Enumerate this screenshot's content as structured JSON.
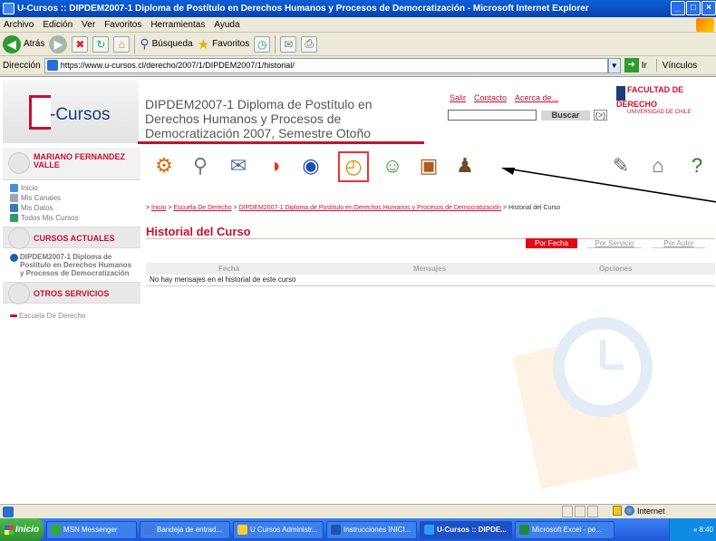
{
  "window": {
    "title": "U-Cursos :: DIPDEM2007-1 Diploma de Postítulo en Derechos Humanos y Procesos de Democratización - Microsoft Internet Explorer",
    "controls": [
      "_",
      "□",
      "×"
    ]
  },
  "menubar": [
    "Archivo",
    "Edición",
    "Ver",
    "Favoritos",
    "Herramientas",
    "Ayuda"
  ],
  "toolbar": {
    "back_label": "Atrás",
    "search_label": "Búsqueda",
    "favorites_label": "Favoritos"
  },
  "address": {
    "label": "Dirección",
    "url": "https://www.u-cursos.cl/derecho/2007/1/DIPDEM2007/1/historial/",
    "go_label": "Ir",
    "links_label": "Vínculos"
  },
  "header": {
    "logo_text": "-Cursos",
    "course_title": "DIPDEM2007-1 Diploma de Postítulo en Derechos Humanos y Procesos de Democratización 2007, Semestre Otoño",
    "links": [
      "Salir",
      "Contacto",
      "Acerca de..."
    ],
    "search_button": "Buscar",
    "search_go": "(>)",
    "faculty_name": "FACULTAD DE DERECHO",
    "faculty_sub": "UNIVERSIDAD DE CHILE"
  },
  "sidebar": {
    "user_name": "MARIANO FERNANDEZ VALLE",
    "links": [
      "Inicio",
      "Mis Canales",
      "Mis Datos",
      "Todos Mis Cursos"
    ],
    "current_heading": "CURSOS ACTUALES",
    "current_course": "DIPDEM2007-1 Diploma de Postítulo en Derechos Humanos y Procesos de Democratización",
    "other_heading": "OTROS SERVICIOS",
    "other_links": [
      "Escuela De Derecho"
    ]
  },
  "iconbar": {
    "icons": [
      {
        "name": "gears-icon",
        "glyph": "⚙",
        "color": "#d96b00"
      },
      {
        "name": "magnifier-icon",
        "glyph": "⚲",
        "color": "#777777"
      },
      {
        "name": "documents-icon",
        "glyph": "✉",
        "color": "#4a6fb0"
      },
      {
        "name": "calendar-icon",
        "glyph": "◑",
        "color": "#d9421a"
      },
      {
        "name": "chart-icon",
        "glyph": "◉",
        "color": "#1c4fb3"
      },
      {
        "name": "history-icon",
        "glyph": "◴",
        "color": "#e08a00"
      },
      {
        "name": "people-icon",
        "glyph": "☺",
        "color": "#2f9a2f"
      },
      {
        "name": "book-icon",
        "glyph": "▣",
        "color": "#b05a20"
      },
      {
        "name": "teacher-icon",
        "glyph": "♟",
        "color": "#6b4a2a"
      },
      {
        "name": "pencil-icon",
        "glyph": "✎",
        "color": "#6a6a6a"
      },
      {
        "name": "home-icon",
        "glyph": "⌂",
        "color": "#666666"
      },
      {
        "name": "help-icon",
        "glyph": "?",
        "color": "#2a7a2a"
      }
    ]
  },
  "breadcrumb": {
    "links": [
      "Inicio",
      "Escuela De Derecho",
      "DIPDEM2007-1 Diploma de Postítulo en Derechos Humanos y Procesos de Democratización"
    ],
    "current": "Historial del Curso"
  },
  "main": {
    "title": "Historial del Curso",
    "tabs": [
      "Por Fecha",
      "Por Servicio",
      "Por Autor"
    ],
    "columns": [
      "Fecha",
      "Mensajes",
      "Opciones"
    ],
    "empty_message": "No hay mensajes en el historial de este curso"
  },
  "statusbar": {
    "zone": "Internet"
  },
  "taskbar": {
    "start": "Inicio",
    "tasks": [
      {
        "label": "MSN Messenger",
        "color": "#33aa33"
      },
      {
        "label": "Bandeja de entrad...",
        "color": "#4477dd"
      },
      {
        "label": "U Cursos Administr...",
        "color": "#ffcc33"
      },
      {
        "label": "Instrucciones INICI...",
        "color": "#2255aa"
      },
      {
        "label": "U-Cursos :: DIPDE...",
        "color": "#3399ff",
        "active": true
      },
      {
        "label": "Microsoft Excel - pe...",
        "color": "#1f8a3a"
      }
    ],
    "clock": "8:40"
  }
}
